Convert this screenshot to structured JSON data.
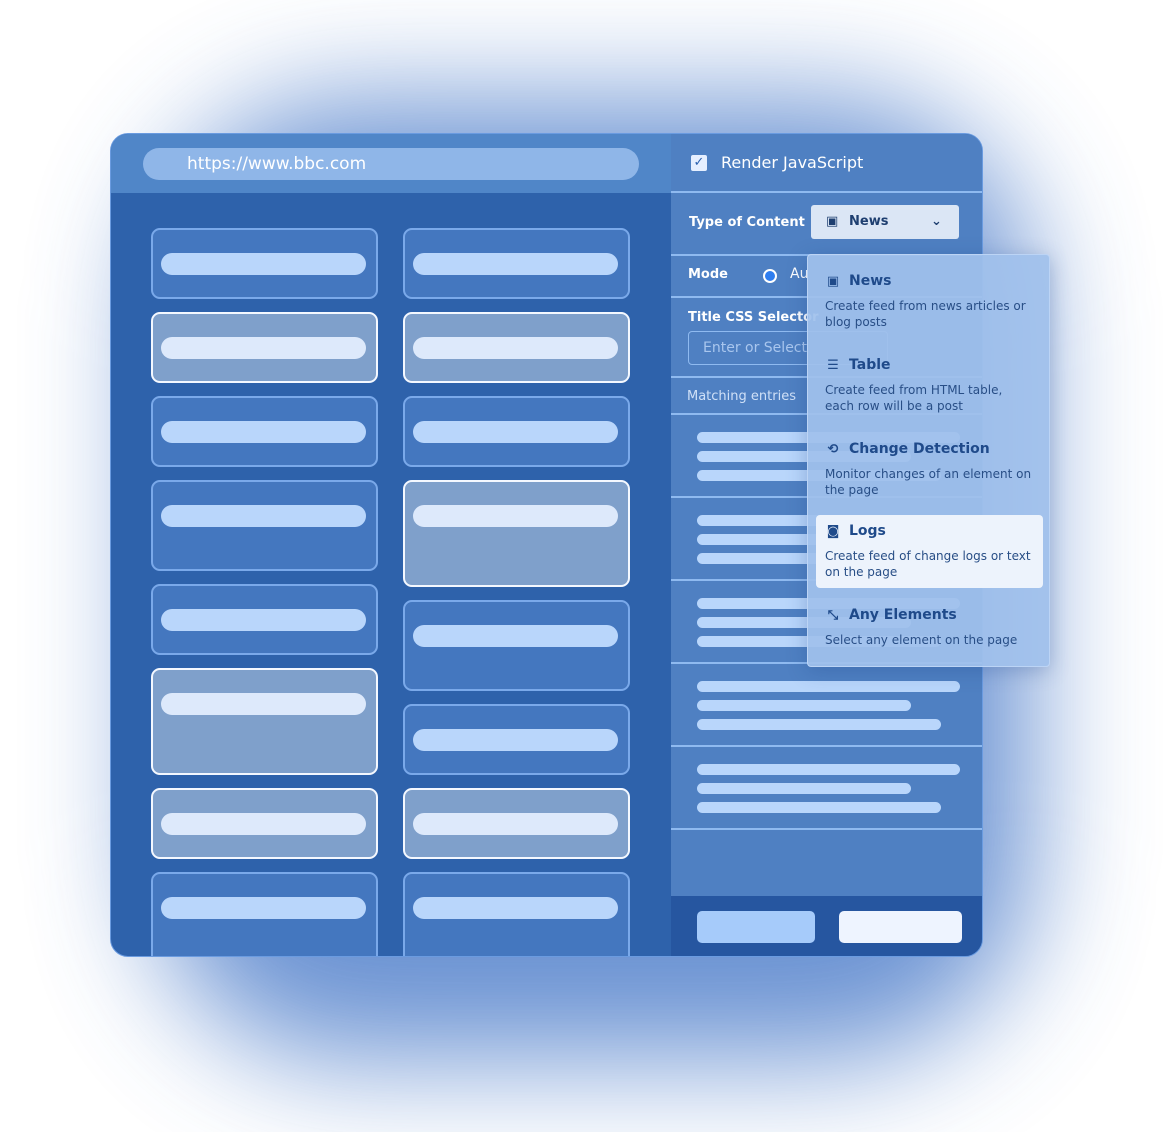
{
  "browser": {
    "url": "https://www.bbc.com"
  },
  "settings": {
    "render_js": {
      "label": "Render JavaScript",
      "checked": true
    },
    "type_of_content": {
      "label": "Type of Content",
      "value": "News",
      "icon": "news-icon"
    },
    "mode": {
      "label": "Mode",
      "option_partial": "Au"
    },
    "title_selector": {
      "label": "Title CSS Selector",
      "placeholder": "Enter or Select"
    },
    "matching_entries": {
      "label": "Matching entries"
    }
  },
  "dropdown": {
    "items": [
      {
        "title": "News",
        "desc": "Create feed from news articles or blog posts",
        "icon": "news-icon"
      },
      {
        "title": "Table",
        "desc": "Create feed from HTML table, each row will be a post",
        "icon": "table-icon"
      },
      {
        "title": "Change Detection",
        "desc": "Monitor changes of an element on the page",
        "icon": "change-detection-icon"
      },
      {
        "title": "Logs",
        "desc": "Create feed of change logs or text on the page",
        "icon": "logs-icon",
        "highlighted": true
      },
      {
        "title": "Any Elements",
        "desc": "Select any element on the page",
        "icon": "any-elements-icon"
      }
    ]
  },
  "colors": {
    "accent": "#2e62ab",
    "panel": "#4f80c2",
    "footer": "#2656a0"
  }
}
